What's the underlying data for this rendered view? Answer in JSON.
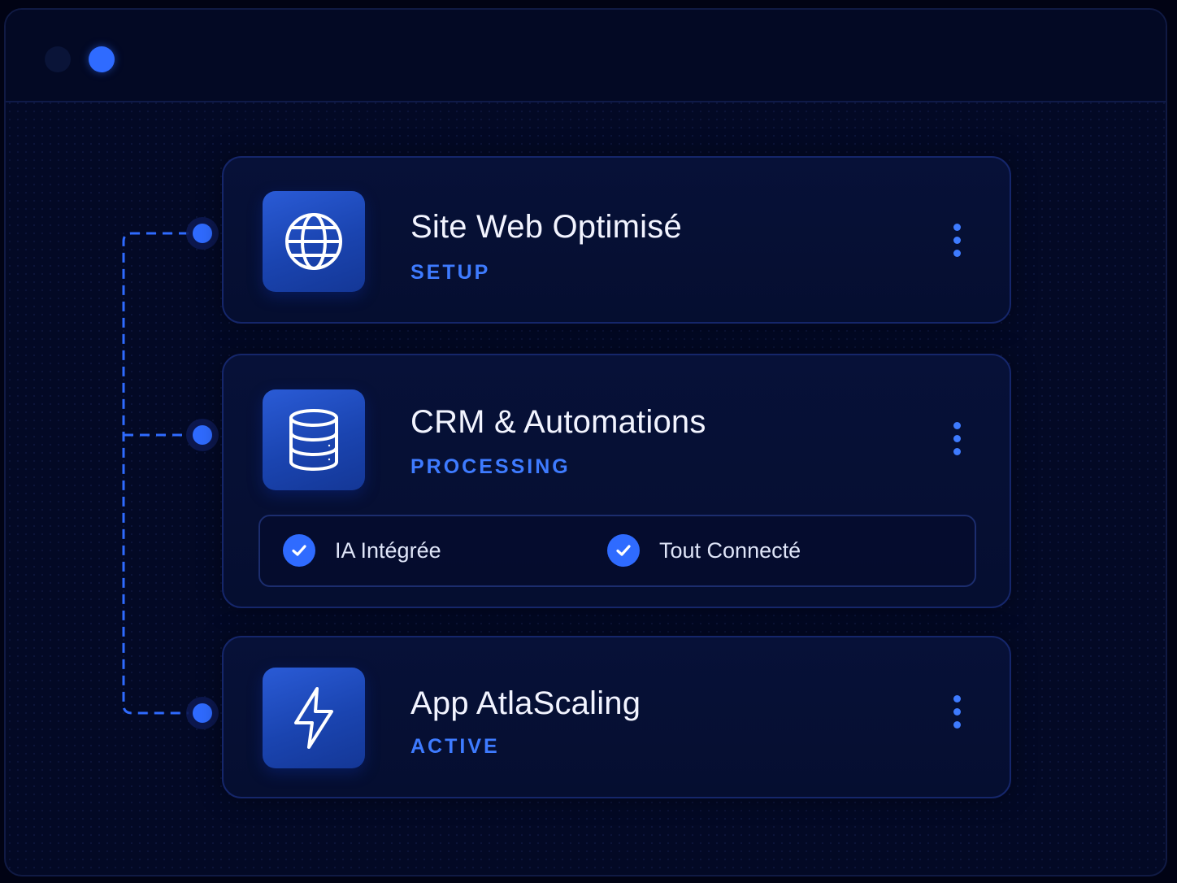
{
  "window": {
    "controls": [
      "window-dot-inactive",
      "window-dot-active"
    ]
  },
  "cards": [
    {
      "title": "Site Web Optimisé",
      "status": "SETUP",
      "icon": "globe-icon"
    },
    {
      "title": "CRM & Automations",
      "status": "PROCESSING",
      "icon": "database-icon",
      "features": [
        {
          "label": "IA Intégrée",
          "icon": "check-icon"
        },
        {
          "label": "Tout Connecté",
          "icon": "check-icon"
        }
      ]
    },
    {
      "title": "App AtlaScaling",
      "status": "ACTIVE",
      "icon": "lightning-icon"
    }
  ],
  "colors": {
    "background": "#030925",
    "card": "#071138",
    "accent": "#2f6bff",
    "status_text": "#3e7bff",
    "title_text": "#f2f4ff"
  }
}
